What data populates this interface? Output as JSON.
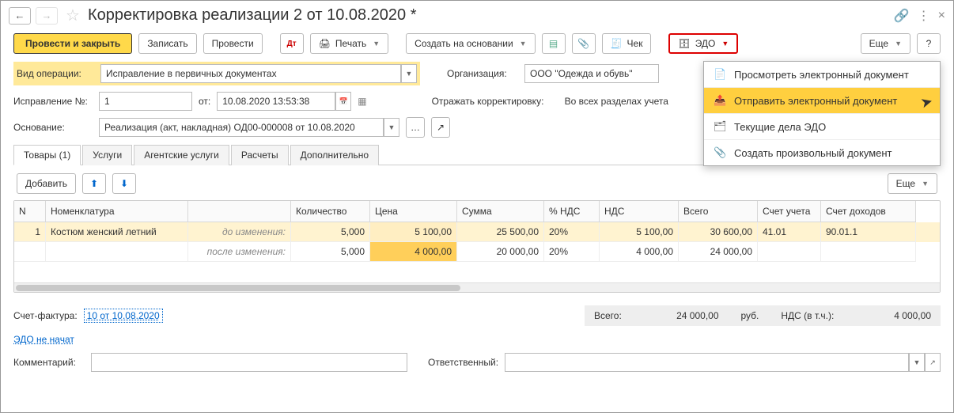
{
  "title": "Корректировка реализации 2 от 10.08.2020 *",
  "toolbar": {
    "post_close": "Провести и закрыть",
    "save": "Записать",
    "post": "Провести",
    "print": "Печать",
    "create_based": "Создать на основании",
    "check": "Чек",
    "edo": "ЭДО",
    "more": "Еще",
    "help": "?"
  },
  "labels": {
    "op_type": "Вид операции:",
    "org": "Организация:",
    "correction_no": "Исправление №:",
    "from": "от:",
    "reflect": "Отражать корректировку:",
    "basis": "Основание:",
    "invoice": "Счет-фактура:",
    "edo_status": "ЭДО не начат",
    "comment": "Комментарий:",
    "responsible": "Ответственный:"
  },
  "fields": {
    "op_type": "Исправление в первичных документах",
    "org": "ООО \"Одежда и обувь\"",
    "correction_no": "1",
    "date": "10.08.2020 13:53:38",
    "reflect": "Во всех разделах учета",
    "basis": "Реализация (акт, накладная) ОД00-000008 от 10.08.2020",
    "invoice": "10 от 10.08.2020",
    "comment": "",
    "responsible": ""
  },
  "tabs": [
    "Товары (1)",
    "Услуги",
    "Агентские услуги",
    "Расчеты",
    "Дополнительно"
  ],
  "subtoolbar": {
    "add": "Добавить",
    "more": "Еще"
  },
  "grid": {
    "cols": [
      "N",
      "Номенклатура",
      "",
      "Количество",
      "Цена",
      "Сумма",
      "% НДС",
      "НДС",
      "Всего",
      "Счет учета",
      "Счет доходов"
    ],
    "rows": [
      {
        "n": "1",
        "name": "Костюм женский летний",
        "change": "до изменения:",
        "qty": "5,000",
        "price": "5 100,00",
        "sum": "25 500,00",
        "vat_pct": "20%",
        "vat": "5 100,00",
        "total": "30 600,00",
        "acct": "41.01",
        "income_acct": "90.01.1"
      },
      {
        "n": "",
        "name": "",
        "change": "после изменения:",
        "qty": "5,000",
        "price": "4 000,00",
        "sum": "20 000,00",
        "vat_pct": "20%",
        "vat": "4 000,00",
        "total": "24 000,00",
        "acct": "",
        "income_acct": ""
      }
    ]
  },
  "totals": {
    "label_total": "Всего:",
    "total": "24 000,00",
    "currency": "руб.",
    "label_vat": "НДС (в т.ч.):",
    "vat": "4 000,00"
  },
  "dropdown": {
    "view": "Просмотреть электронный документ",
    "send": "Отправить электронный документ",
    "current": "Текущие дела ЭДО",
    "create": "Создать произвольный документ"
  }
}
